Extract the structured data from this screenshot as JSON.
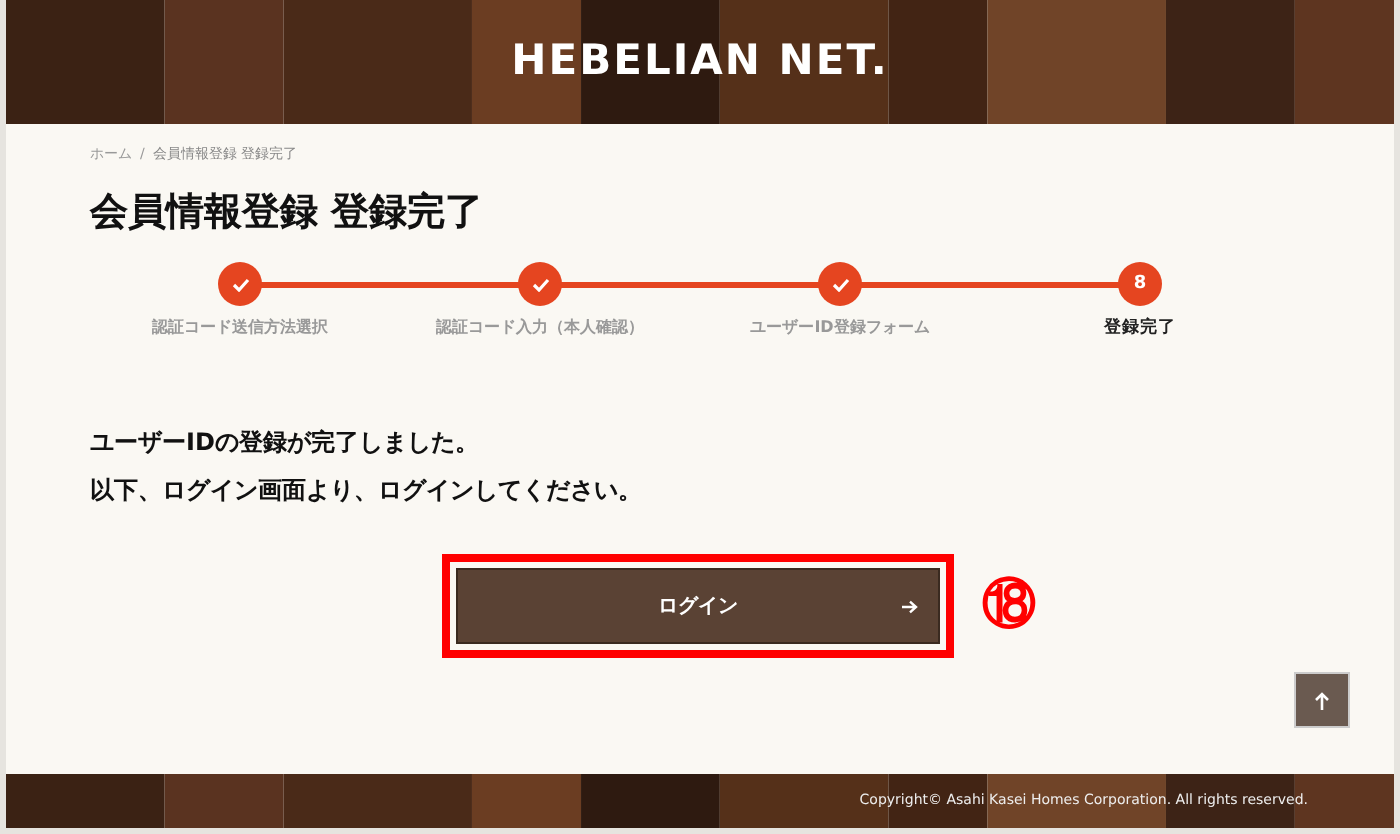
{
  "header": {
    "title": "HEBELIAN NET."
  },
  "breadcrumb_separator": "/",
  "breadcrumb": [
    {
      "label": "ホーム",
      "current": false
    },
    {
      "label": "会員情報登録 登録完了",
      "current": true
    }
  ],
  "page_title": "会員情報登録 登録完了",
  "steps": [
    {
      "label": "認証コード送信方法選択",
      "completed": true
    },
    {
      "label": "認証コード入力（本人確認）",
      "completed": true
    },
    {
      "label": "ユーザーID登録フォーム",
      "completed": true
    },
    {
      "label": "登録完了",
      "completed": false,
      "number": "8"
    }
  ],
  "message": [
    "ユーザーIDの登録が完了しました。",
    "以下、ログイン画面より、ログインしてください。"
  ],
  "login_button": {
    "label": "ログイン",
    "highlighted": true,
    "annotation": "⑱"
  },
  "footer": {
    "copyright": "Copyright© Asahi Kasei Homes Corporation. All rights reserved."
  }
}
